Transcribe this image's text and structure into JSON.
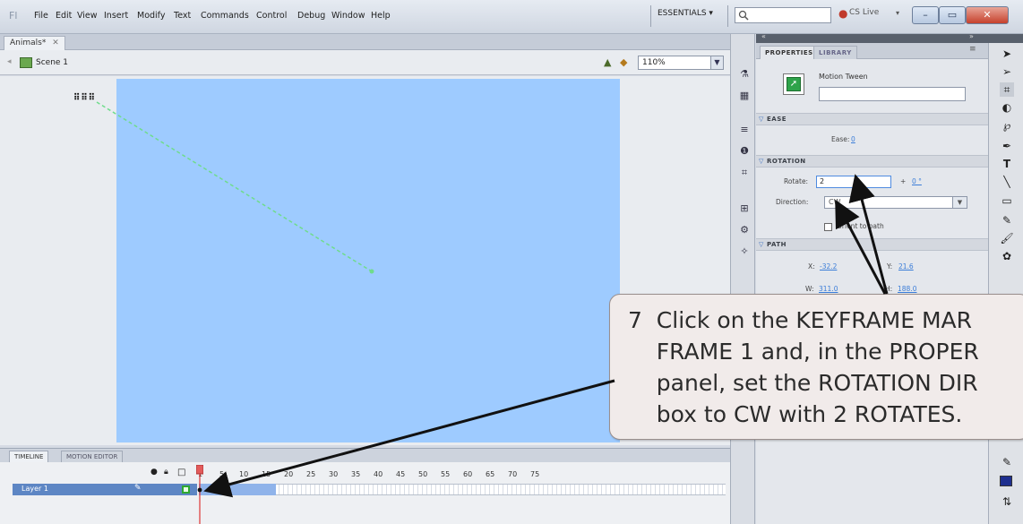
{
  "menubar": {
    "logo": "Fl",
    "items": [
      "File",
      "Edit",
      "View",
      "Insert",
      "Modify",
      "Text",
      "Commands",
      "Control",
      "Debug",
      "Window",
      "Help"
    ],
    "workspace": "ESSENTIALS ▾",
    "search_icon": "magnifier-icon",
    "cs_live": "CS Live"
  },
  "document": {
    "tab_label": "Animals*",
    "scene_label": "Scene 1",
    "zoom": "110%",
    "animal_glyph": "⠿⠿⠿"
  },
  "timeline": {
    "tabs": [
      "TIMELINE",
      "MOTION EDITOR"
    ],
    "frame_numbers": [
      "1",
      "5",
      "10",
      "15",
      "20",
      "25",
      "30",
      "35",
      "40",
      "45",
      "50",
      "55",
      "60",
      "65",
      "70",
      "75"
    ],
    "layer_name": "Layer 1"
  },
  "properties": {
    "tabs": [
      "PROPERTIES",
      "LIBRARY"
    ],
    "object_type": "Motion Tween",
    "instance_name_value": "",
    "ease_section": "EASE",
    "ease_label": "Ease:",
    "ease_value": "0",
    "rotation_section": "ROTATION",
    "rotate_label": "Rotate:",
    "rotate_value": "2",
    "degrees_sep": "+",
    "degrees_value": "0 °",
    "direction_label": "Direction:",
    "direction_value": "CW",
    "orient_label": "Orient to path",
    "path_section": "PATH",
    "x_label": "X:",
    "x_value": "-32.2",
    "y_label": "Y:",
    "y_value": "21.6",
    "w_label": "W:",
    "w_value": "311.0",
    "h_label": "H:",
    "h_value": "188.0"
  },
  "callout": {
    "text": "7  Click on the KEYFRAME MAR\n    FRAME 1 and, in the PROPER\n    panel, set the ROTATION DIR\n    box to CW with 2 ROTATES."
  },
  "colors": {
    "stage": "#9ecbff",
    "layer_selected": "#5d86c4",
    "tween_span": "#8fb3ea",
    "keyframe": "#2fa82f",
    "fill_color": "#1e2f8f"
  }
}
